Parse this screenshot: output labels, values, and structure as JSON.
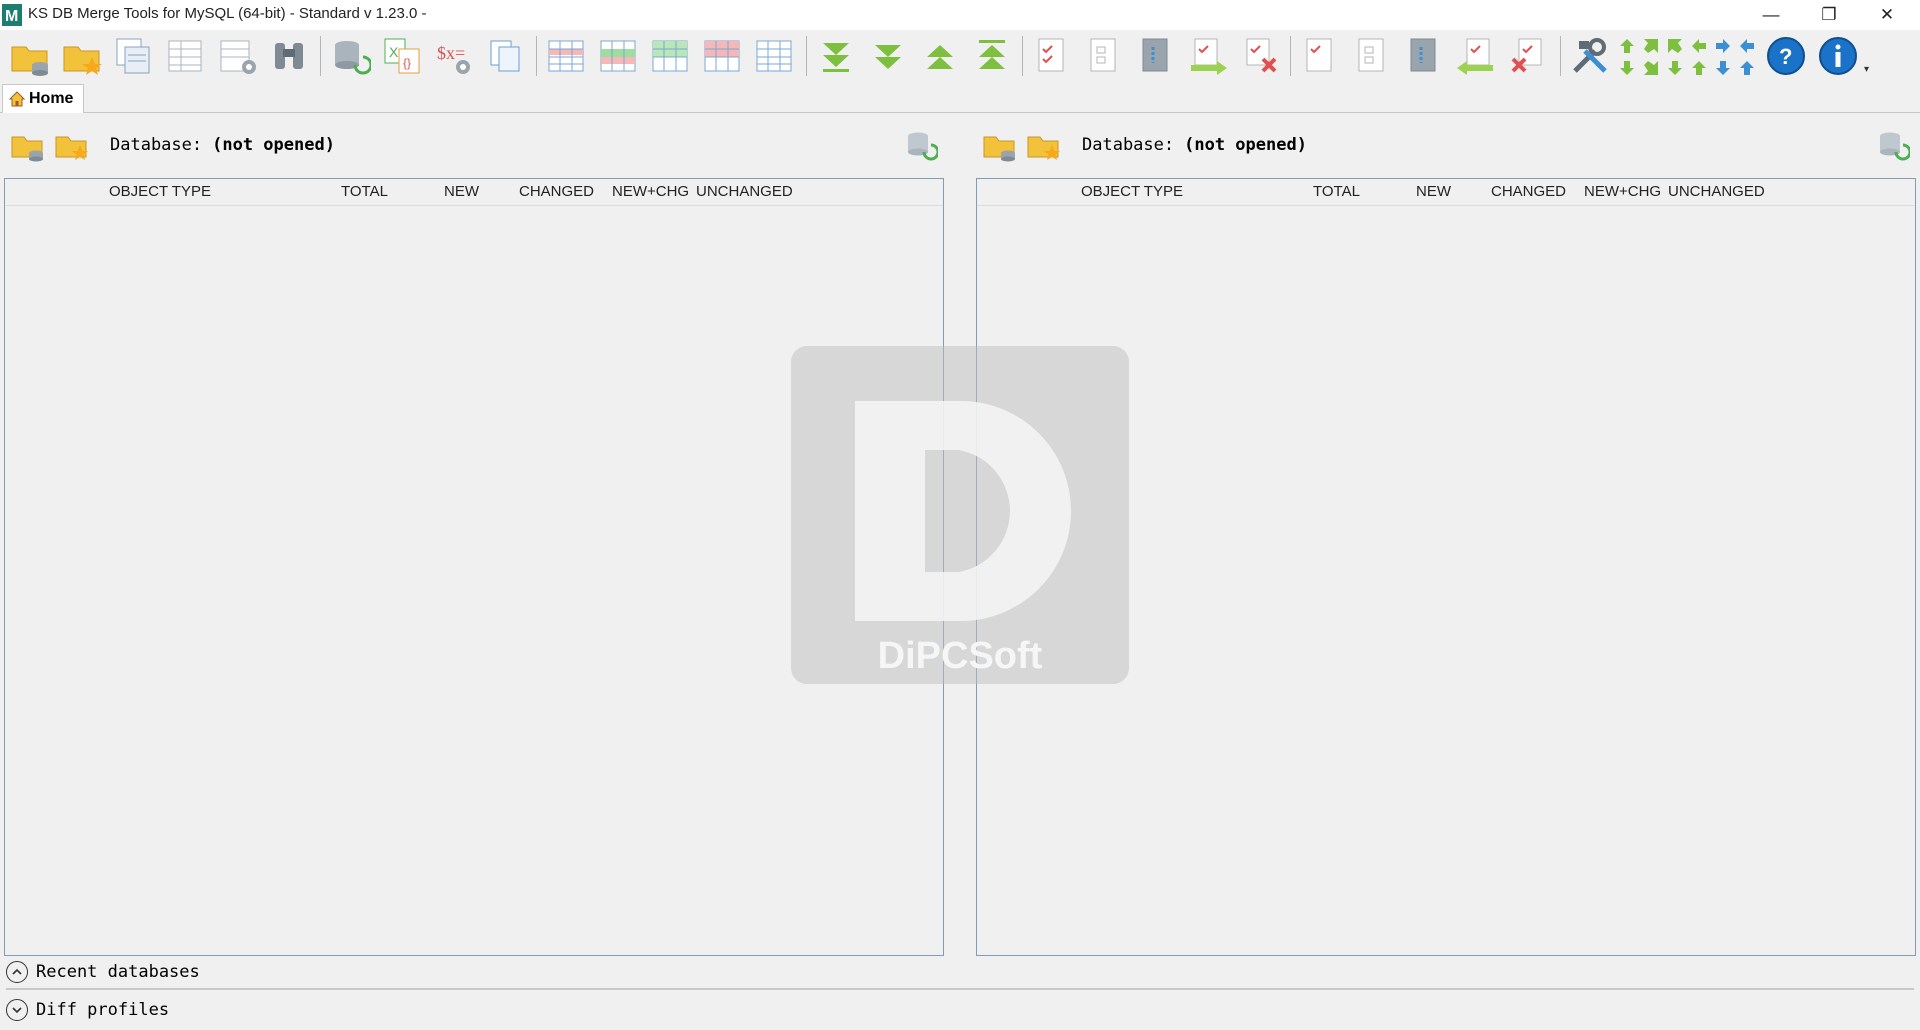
{
  "window": {
    "title": "KS DB Merge Tools for MySQL (64-bit) - Standard v 1.23.0 -",
    "minimize_glyph": "—",
    "restore_glyph": "❐",
    "close_glyph": "✕"
  },
  "toolbar": {
    "icons": [
      "open-database-icon",
      "favorite-database-icon",
      "copy-objects-icon",
      "query-table-icon",
      "table-settings-icon",
      "search-binoculars-icon",
      "refresh-compare-icon",
      "export-excel-icon",
      "script-settings-icon",
      "copy-document-icon",
      "grid-new-icon",
      "grid-green-icon",
      "grid-changed-icon",
      "grid-red-icon",
      "grid-all-icon",
      "next-diff-down-icon",
      "next-diff-icon",
      "prev-diff-icon",
      "prev-diff-up-icon",
      "check-doc-icon",
      "blank-doc-icon",
      "doc-chain-icon",
      "copy-right-icon",
      "delete-right-icon",
      "check-doc-2-icon",
      "blank-doc-2-icon",
      "doc-chain-2-icon",
      "copy-left-icon",
      "delete-left-icon",
      "tools-icon",
      "arrows-icon",
      "help-icon",
      "info-icon"
    ],
    "overflow_glyph": "▾"
  },
  "tabs": {
    "home_label": "Home"
  },
  "left_panel": {
    "database_label": "Database:",
    "database_status": "(not opened)",
    "columns": [
      "OBJECT TYPE",
      "TOTAL",
      "NEW",
      "CHANGED",
      "NEW+CHG",
      "UNCHANGED"
    ]
  },
  "right_panel": {
    "database_label": "Database:",
    "database_status": "(not opened)",
    "columns": [
      "OBJECT TYPE",
      "TOTAL",
      "NEW",
      "CHANGED",
      "NEW+CHG",
      "UNCHANGED"
    ]
  },
  "watermark": {
    "letter": "D",
    "brand": "DiPCSoft"
  },
  "sections": {
    "recent_label": "Recent databases",
    "diff_label": "Diff profiles",
    "recent_chevron": "⌃",
    "diff_chevron": "⌄"
  },
  "colors": {
    "accent_blue": "#1a73c9",
    "folder_yellow": "#f2c23a",
    "green": "#4caf50",
    "red": "#e05050"
  }
}
